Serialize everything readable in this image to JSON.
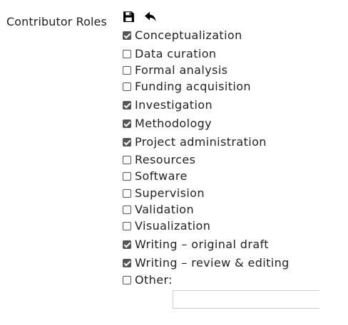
{
  "field": {
    "label": "Contributor Roles"
  },
  "toolbar": {
    "save_icon": "save-icon",
    "undo_icon": "undo-icon"
  },
  "roles": [
    {
      "label": "Conceptualization",
      "checked": true
    },
    {
      "label": "Data curation",
      "checked": false
    },
    {
      "label": "Formal analysis",
      "checked": false
    },
    {
      "label": "Funding acquisition",
      "checked": false
    },
    {
      "label": "Investigation",
      "checked": true
    },
    {
      "label": "Methodology",
      "checked": true
    },
    {
      "label": "Project administration",
      "checked": true
    },
    {
      "label": "Resources",
      "checked": false
    },
    {
      "label": "Software",
      "checked": false
    },
    {
      "label": "Supervision",
      "checked": false
    },
    {
      "label": "Validation",
      "checked": false
    },
    {
      "label": "Visualization",
      "checked": false
    },
    {
      "label": "Writing – original draft",
      "checked": true
    },
    {
      "label": "Writing – review & editing",
      "checked": true
    },
    {
      "label": "Other:",
      "checked": false
    }
  ],
  "other": {
    "value": "",
    "placeholder": ""
  },
  "colors": {
    "checkbox": "#555555",
    "text": "#222222",
    "input_border": "#cccccc"
  }
}
